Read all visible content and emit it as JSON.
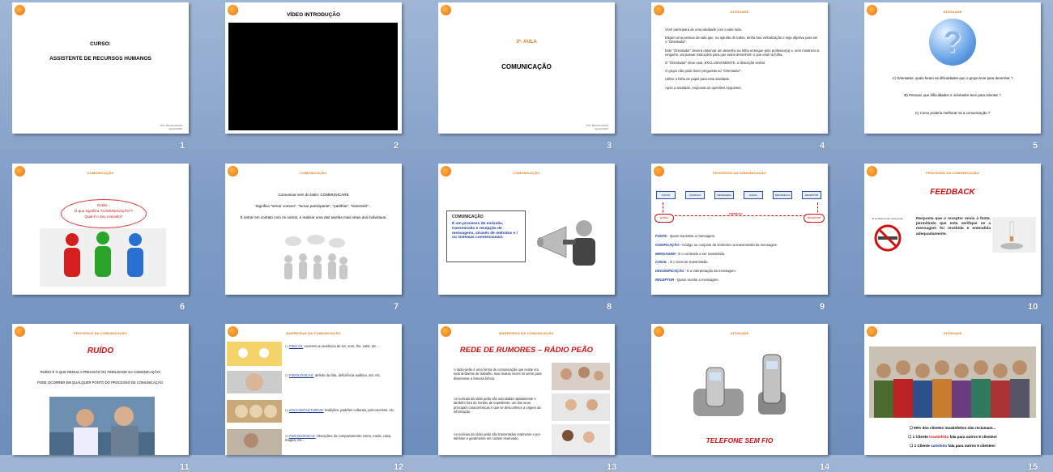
{
  "slides": [
    {
      "number": "1",
      "course_label": "CURSO:",
      "course_name": "ASSISTENTE DE RECURSOS HUMANOS",
      "credit": "Prof. Marcelo Rocha Agosto/2012"
    },
    {
      "number": "2",
      "title": "VÍDEO INTRODUÇÃO"
    },
    {
      "number": "3",
      "class": "3ª. AULA",
      "title": "COMUNICAÇÃO",
      "credit": "Prof. Marcelo Rocha Agosto/2012"
    },
    {
      "number": "4",
      "header": "ATIVIDADE",
      "lines": [
        "Você participará de uma atividade com a sala toda.",
        "Elejam uma pessoa da sala que, na opinião de todos, tenha boa verbalização e seja objetiva para ser o “Orientador”.",
        "Este “Orientador” deverá observar um desenho na folha entregue pelo professor(a) e, sem mostrá-la à ninguém, vai passar instruções para que todos desenhem o que está na folha.",
        "O “Orientador” deve usar, EXCLUSIVAMENTE, a descrição verbal.",
        "O grupo não pode fazer perguntas ao “Orientador”.",
        "Utilize a folha de papel para esta atividade.",
        "Após a atividade, responda as questões seguintes."
      ]
    },
    {
      "number": "5",
      "header": "ATIVIDADE",
      "symbol": "?",
      "questions": [
        "A) Orientador, quais foram as dificuldades que o grupo teve para desenhar ?",
        "B) Pessoal, que dificuldades o orientador teve para orientar ?",
        "C) Como poderia melhorar-se a comunicação ?"
      ]
    },
    {
      "number": "6",
      "header": "COMUNICAÇÃO",
      "bubble_1": "Então...",
      "bubble_2": "O que significa “COMUNICAÇÃO”?",
      "bubble_3": "Qual é o seu conceito?"
    },
    {
      "number": "7",
      "header": "COMUNICAÇÃO",
      "line_1": "Comunicar vem do latim: COMMUNICARE",
      "line_2": "Significa “tornar comum”, “tornar participante”, “partilhar”, “transmitir”...",
      "line_3": "É entrar em contato com os outros, é realizar uma das tarefas mais vitais dos indivíduos."
    },
    {
      "number": "8",
      "header": "COMUNICAÇÃO",
      "box_title": "COMUNICAÇÃO",
      "box_text": "É um processo de emissão, transmissão e recepção de mensagens, através de métodos e / ou sistemas convencionais."
    },
    {
      "number": "9",
      "header": "PROCESSO DA COMUNICAÇÃO",
      "flow": [
        "FONTE",
        "CODIFICA",
        "MENSAGEM",
        "CANAL",
        "DECODIFICA",
        "RECEPTOR"
      ],
      "flow_bottom_left": "RUÍDO",
      "flow_bottom_mid": "FEEDBACK",
      "flow_bottom_right": "RECEPTOR",
      "defs": [
        {
          "term": "FONTE",
          "text": " - Quem transmite a mensagem."
        },
        {
          "term": "CODIFICAÇÃO",
          "text": " - Código ou conjunto de símbolos na transmissão da mensagem."
        },
        {
          "term": "MENSAGEM",
          "text": " - É o conteúdo a ser transmitido."
        },
        {
          "term": "CANAL",
          "text": " - É o meio de transmissão."
        },
        {
          "term": "DECODIFICAÇÃO",
          "text": " - É a interpretação da mensagem."
        },
        {
          "term": "RECEPTOR",
          "text": " - Quem recebe a mensagem."
        }
      ]
    },
    {
      "number": "10",
      "header": "PROCESSO DA COMUNICAÇÃO",
      "title": "FEEDBACK",
      "sign_text": "É proibido fumar neste local.",
      "text": "Resposta que o receptor envia à fonte, permitindo que esta verifique se a mensagem foi recebida e entendida adequadamente."
    },
    {
      "number": "11",
      "header": "PROCESSO DA COMUNICAÇÃO",
      "title": "RUÍDO",
      "line_1": "RUÍDO É O QUE REDUZ A PRECISÃO OU FIDELIDADE DA COMUNICAÇÃO!",
      "line_2": "PODE OCORRER EM QUALQUER PONTO DO PROCESSO DE COMUNICAÇÃO."
    },
    {
      "number": "12",
      "header": "BARREIRAS NA COMUNICAÇÃO",
      "items": [
        {
          "term": "FÍSICAS:",
          "text": " excesso ou ausência de luz, som, frio, calor, etc..."
        },
        {
          "term": "FISIOLÓGICAS:",
          "text": " defeito da fala, deficiência auditiva, dor, etc."
        },
        {
          "term": "SOCIAIS/CULTURAIS:",
          "text": " tradições, padrões culturais, preconceitos, etc."
        },
        {
          "term": "PSICOLÓGICAS:",
          "text": " Alterações do comportamento como, medo, raiva, mágoa, etc..."
        }
      ]
    },
    {
      "number": "13",
      "header": "BARREIRAS NA COMUNICAÇÃO",
      "title": "REDE DE RUMORES – RÁDIO PEÃO",
      "paras": [
        "A rádio-peão é uma forma de comunicação que existe em todo ambiente de trabalho, mas muitas vezes só serve para disseminar a famosa fofoca.",
        "As notícias da rádio peão são veiculadas rapidamente e também fora do horário de expediente, um dos seus principais características é que se desconhece a origem da informação.",
        "As notícias da rádio peão são transmitidas oralmente e por telefone e geralmente em caráter reservado."
      ]
    },
    {
      "number": "14",
      "header": "ATIVIDADE",
      "title": "TELEFONE SEM FIO"
    },
    {
      "number": "15",
      "header": "ATIVIDADE",
      "items": [
        {
          "pre": "90% dos clientes insatisfeitos não reclamam...",
          "hl": "",
          "post": ""
        },
        {
          "pre": "1 Cliente ",
          "hl": "insatisfeito",
          "post": " fala para outros 9 clientes!"
        },
        {
          "pre": "1 Cliente ",
          "hl": "satisfeito",
          "post": " fala para outros 5 clientes!"
        }
      ]
    }
  ],
  "colors": {
    "accent_orange": "#e8790e",
    "title_red": "#d01010",
    "term_blue": "#1a3b9c"
  }
}
